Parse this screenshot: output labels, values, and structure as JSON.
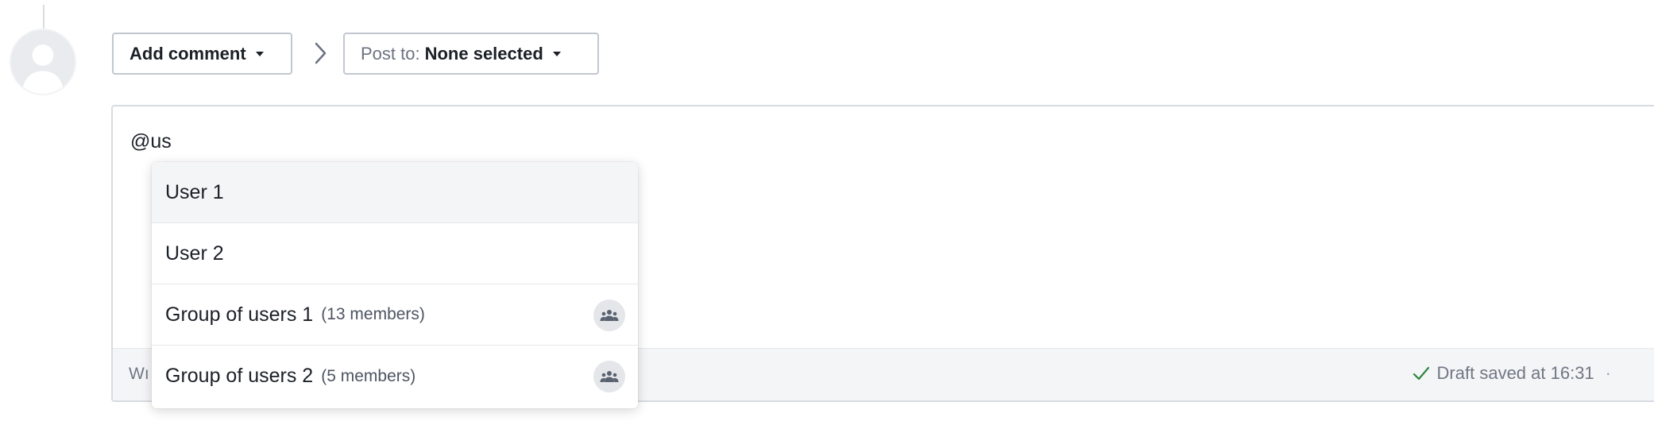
{
  "toolbar": {
    "add_comment_label": "Add comment",
    "post_to_prefix": "Post to:",
    "post_to_value": "None selected"
  },
  "editor": {
    "text": "@us",
    "footer_hint_visible": "Wı",
    "draft_status": "Draft saved at 16:31",
    "draft_trailing": "·"
  },
  "mention_menu": {
    "options": [
      {
        "label": "User 1",
        "count": "",
        "type": "user"
      },
      {
        "label": "User 2",
        "count": "",
        "type": "user"
      },
      {
        "label": "Group of users 1",
        "count": "(13 members)",
        "type": "group"
      },
      {
        "label": "Group of users 2",
        "count": "(5 members)",
        "type": "group"
      }
    ]
  },
  "icons": {
    "avatar": "user-avatar-placeholder",
    "breadcrumb": "chevron-right-icon",
    "dropdown": "caret-down-icon",
    "draft": "checkmark-icon",
    "group": "group-icon"
  },
  "colors": {
    "border": "#c2c7cf",
    "footer_bg": "#f4f5f7",
    "active_option_bg": "#f4f5f7",
    "check_green": "#2e8540"
  }
}
